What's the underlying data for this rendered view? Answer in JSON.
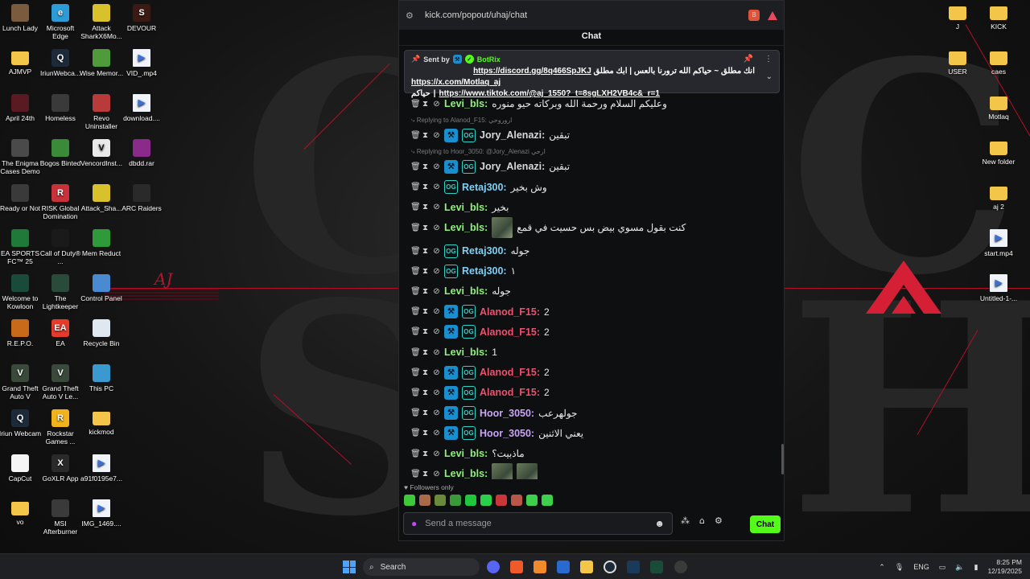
{
  "desktop_left": [
    {
      "label": "Lunch Lady",
      "color": "#7a5b3e",
      "glyph": ""
    },
    {
      "label": "Microsoft Edge",
      "color": "#2c9bd6",
      "glyph": "e"
    },
    {
      "label": "Attack SharkX6Mo...",
      "color": "#d8c12a",
      "glyph": ""
    },
    {
      "label": "DEVOUR",
      "color": "#3a1a12",
      "glyph": "S"
    },
    {
      "label": "AJMVP",
      "color": "#f3c64a",
      "glyph": ""
    },
    {
      "label": "IriunWebca...",
      "color": "#1c2a3a",
      "glyph": "Q"
    },
    {
      "label": "Wise Memor...",
      "color": "#4f9a3a",
      "glyph": ""
    },
    {
      "label": "VID_.mp4",
      "color": "#f0f4fa",
      "glyph": "▶"
    },
    {
      "label": "April 24th",
      "color": "#5a1a22",
      "glyph": ""
    },
    {
      "label": "Homeless",
      "color": "#3a3a3a",
      "glyph": ""
    },
    {
      "label": "Revo Uninstaller",
      "color": "#b83a3a",
      "glyph": ""
    },
    {
      "label": "download....",
      "color": "#f0f4fa",
      "glyph": "▶"
    },
    {
      "label": "The Enigma Cases Demo",
      "color": "#4a4a4a",
      "glyph": ""
    },
    {
      "label": "Bogos Binted",
      "color": "#3a8a3a",
      "glyph": ""
    },
    {
      "label": "VencordInst...",
      "color": "#eaeaea",
      "glyph": "V"
    },
    {
      "label": "dbdd.rar",
      "color": "#8a2a8a",
      "glyph": ""
    },
    {
      "label": "Ready or Not",
      "color": "#3a3a3a",
      "glyph": ""
    },
    {
      "label": "RISK Global Domination",
      "color": "#c8323a",
      "glyph": "R"
    },
    {
      "label": "Attack_Sha...",
      "color": "#d8c12a",
      "glyph": ""
    },
    {
      "label": "ARC Raiders",
      "color": "#2a2a2a",
      "glyph": ""
    },
    {
      "label": "EA SPORTS FC™ 25",
      "color": "#1f7a3a",
      "glyph": ""
    },
    {
      "label": "Call of Duty® ...",
      "color": "#1a1a1a",
      "glyph": ""
    },
    {
      "label": "Mem Reduct",
      "color": "#2e9a3a",
      "glyph": ""
    },
    {
      "label": "Welcome to Kowloon",
      "color": "#1a4a3a",
      "glyph": ""
    },
    {
      "label": "The Lightkeeper",
      "color": "#2a4a3a",
      "glyph": ""
    },
    {
      "label": "Control Panel",
      "color": "#4a8ad0",
      "glyph": ""
    },
    {
      "label": "R.E.P.O.",
      "color": "#c86a1a",
      "glyph": ""
    },
    {
      "label": "EA",
      "color": "#e63a2a",
      "glyph": "EA"
    },
    {
      "label": "Recycle Bin",
      "color": "#dfe8f0",
      "glyph": ""
    },
    {
      "label": "Grand Theft Auto V",
      "color": "#3a4a3a",
      "glyph": "V"
    },
    {
      "label": "Grand Theft Auto V Le...",
      "color": "#3a4a3a",
      "glyph": "V"
    },
    {
      "label": "This PC",
      "color": "#3a9ad0",
      "glyph": ""
    },
    {
      "label": "Iriun Webcam",
      "color": "#1c2a3a",
      "glyph": "Q"
    },
    {
      "label": "Rockstar Games ...",
      "color": "#f2b21a",
      "glyph": "R"
    },
    {
      "label": "kickmod",
      "color": "#f3c64a",
      "glyph": ""
    },
    {
      "label": "CapCut",
      "color": "#f5f5f5",
      "glyph": ""
    },
    {
      "label": "GoXLR App",
      "color": "#2a2a2a",
      "glyph": "X"
    },
    {
      "label": "a91f0195e7...",
      "color": "#f0f4fa",
      "glyph": "▶"
    },
    {
      "label": "vo",
      "color": "#f3c64a",
      "glyph": ""
    },
    {
      "label": "MSI Afterburner",
      "color": "#3a3a3a",
      "glyph": ""
    },
    {
      "label": "IMG_1469....",
      "color": "#f0f4fa",
      "glyph": "▶"
    }
  ],
  "desktop_right": [
    {
      "label": "J",
      "color": "#f3c64a"
    },
    {
      "label": "KICK",
      "color": "#f3c64a"
    },
    {
      "label": "USER",
      "color": "#f3c64a"
    },
    {
      "label": "caes",
      "color": "#f3c64a"
    },
    {
      "label": "Motlaq",
      "color": "#f3c64a"
    },
    {
      "label": "New folder",
      "color": "#f3c64a"
    },
    {
      "label": "aj 2",
      "color": "#f3c64a"
    },
    {
      "label": "start.mp4",
      "color": "#f0f4fa"
    },
    {
      "label": "Untitled-1-...",
      "color": "#f0f4fa"
    }
  ],
  "wallpaper": {
    "aj_logo": "AJ"
  },
  "browser": {
    "url": "kick.com/popout/uhaj/chat",
    "chat_title": "Chat"
  },
  "pinned": {
    "sent_by": "Sent by",
    "bot_name": "BotRix",
    "line1_arabic": "انك مطلق ~ حياكم الله ترورنا بالعس | ابك مطلق",
    "line1_link": "https://discord.gg/8q466SpJKJ",
    "line2_link": "https://x.com/Motlaq_aj",
    "line3_link": "https://www.tiktok.com/@aj_1550?_t=8sgLXH2VB4c&_r=1",
    "line3_arabic": "حياكم"
  },
  "messages": [
    {
      "user": "Levi_bls",
      "color": "#8ef27a",
      "badges": [],
      "text": "وعليكم السلام ورحمة الله وبركاته حيو منوره",
      "emotes": 0
    },
    {
      "user": "Jory_Alenazi",
      "color": "#d8d8d8",
      "badges": [
        "hammer",
        "og"
      ],
      "text": "تبقين",
      "emotes": 0,
      "reply": "Replying to Alanod_F15: اروروحي"
    },
    {
      "user": "Jory_Alenazi",
      "color": "#d8d8d8",
      "badges": [
        "hammer",
        "og"
      ],
      "text": "تبقين",
      "emotes": 0,
      "reply": "Replying to Hoor_3050: @Jory_Alenazi ارحي"
    },
    {
      "user": "Retaj300",
      "color": "#7ed0f5",
      "badges": [
        "og"
      ],
      "text": "وش بخير",
      "emotes": 0
    },
    {
      "user": "Levi_bls",
      "color": "#8ef27a",
      "badges": [],
      "text": "بخير",
      "emotes": 0
    },
    {
      "user": "Levi_bls",
      "color": "#8ef27a",
      "badges": [],
      "text": "كنت بقول مسوي بيض بس حسيت في قمع",
      "emotes": 1
    },
    {
      "user": "Retaj300",
      "color": "#7ed0f5",
      "badges": [
        "og"
      ],
      "text": "جوله",
      "emotes": 0
    },
    {
      "user": "Retaj300",
      "color": "#7ed0f5",
      "badges": [
        "og"
      ],
      "text": "١",
      "emotes": 0
    },
    {
      "user": "Levi_bls",
      "color": "#8ef27a",
      "badges": [],
      "text": "جوله",
      "emotes": 0
    },
    {
      "user": "Alanod_F15",
      "color": "#f0506e",
      "badges": [
        "hammer",
        "og"
      ],
      "text": "2",
      "emotes": 0
    },
    {
      "user": "Alanod_F15",
      "color": "#f0506e",
      "badges": [
        "hammer",
        "og"
      ],
      "text": "2",
      "emotes": 0
    },
    {
      "user": "Levi_bls",
      "color": "#8ef27a",
      "badges": [],
      "text": "1",
      "emotes": 0
    },
    {
      "user": "Alanod_F15",
      "color": "#f0506e",
      "badges": [
        "hammer",
        "og"
      ],
      "text": "2",
      "emotes": 0
    },
    {
      "user": "Alanod_F15",
      "color": "#f0506e",
      "badges": [
        "hammer",
        "og"
      ],
      "text": "2",
      "emotes": 0
    },
    {
      "user": "Hoor_3050",
      "color": "#c9a5f5",
      "badges": [
        "hammer",
        "og"
      ],
      "text": "جولهرعب",
      "emotes": 0
    },
    {
      "user": "Hoor_3050",
      "color": "#c9a5f5",
      "badges": [
        "hammer",
        "og"
      ],
      "text": "يعني الاثنين",
      "emotes": 0
    },
    {
      "user": "Levi_bls",
      "color": "#8ef27a",
      "badges": [],
      "text": "ماذبيت؟",
      "emotes": 0
    },
    {
      "user": "Levi_bls",
      "color": "#8ef27a",
      "badges": [],
      "text": "",
      "emotes": 2
    }
  ],
  "chat_footer": {
    "followers_only": "Followers only",
    "placeholder": "Send a message",
    "send_label": "Chat",
    "accent": "#53fc18"
  },
  "taskbar": {
    "search_label": "Search",
    "lang": "ENG",
    "time": "8:25 PM",
    "date": "12/19/2025"
  }
}
